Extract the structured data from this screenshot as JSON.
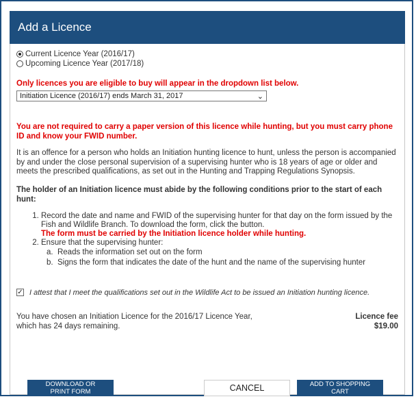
{
  "dialog": {
    "title": "Add a Licence"
  },
  "year_options": [
    {
      "label": "Current Licence Year (2016/17)",
      "selected": true
    },
    {
      "label": "Upcoming Licence Year (2017/18)",
      "selected": false
    }
  ],
  "eligibility_notice": "Only licences you are eligible to buy will appear in the dropdown list below.",
  "licence_select": {
    "value": "Initiation Licence (2016/17) ends March 31, 2017"
  },
  "paper_notice": "You are not required to carry a paper version of this licence while hunting, but you must carry phone ID and know your FWID number.",
  "offence_text": "It is an offence for a person who holds an Initiation hunting licence to hunt, unless the person is accompanied by and under the close personal supervision of a supervising hunter who is 18 years of age or older and meets the prescribed qualifications, as set out in the Hunting and Trapping Regulations Synopsis.",
  "conditions_heading": "The holder of an Initiation licence must abide by the following conditions prior to the start of each hunt:",
  "conditions": {
    "item1": "Record the date and name and FWID of the supervising hunter for that day on the form issued by the Fish and Wildlife Branch. To download the form, click the button.",
    "item1_warning": "The form must be carried by the Initiation licence holder while hunting.",
    "item2": "Ensure that the supervising hunter:",
    "item2a": "Reads the information set out on the form",
    "item2b": "Signs the form that indicates the date of the hunt and the name of the supervising hunter"
  },
  "attestation": {
    "checked": true,
    "label": "I attest that I meet the qualifications set out in the Wildlife Act to be issued an Initiation hunting licence."
  },
  "summary": {
    "text": "You have chosen an Initiation Licence for the 2016/17 Licence Year, which has 24 days remaining.",
    "fee_label": "Licence fee",
    "fee_value": "$19.00"
  },
  "buttons": {
    "download_line1": "DOWNLOAD OR",
    "download_line2": "PRINT FORM",
    "cancel": "CANCEL",
    "add_line1": "ADD TO SHOPPING",
    "add_line2": "CART"
  },
  "colors": {
    "header_bg": "#1d4e7e",
    "warning_red": "#e00000"
  }
}
